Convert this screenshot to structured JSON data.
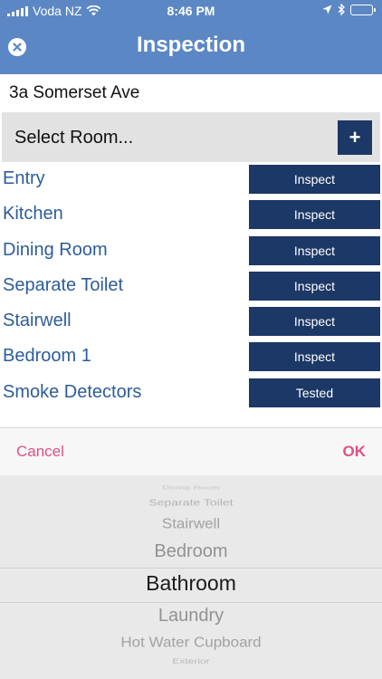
{
  "status_bar": {
    "carrier": "Voda NZ",
    "time": "8:46 PM",
    "icons": [
      "signal-bars-icon",
      "wifi-icon",
      "location-arrow-icon",
      "bluetooth-icon",
      "battery-icon"
    ]
  },
  "header": {
    "title": "Inspection",
    "close_icon": "close-icon"
  },
  "address": "3a Somerset Ave",
  "select_room": {
    "label": "Select Room...",
    "add_label": "+"
  },
  "rooms": [
    {
      "name": "Entry",
      "action": "Inspect"
    },
    {
      "name": "Kitchen",
      "action": "Inspect"
    },
    {
      "name": "Dining Room",
      "action": "Inspect"
    },
    {
      "name": "Separate Toilet",
      "action": "Inspect"
    },
    {
      "name": "Stairwell",
      "action": "Inspect"
    },
    {
      "name": "Bedroom 1",
      "action": "Inspect"
    },
    {
      "name": "Smoke Detectors",
      "action": "Tested"
    }
  ],
  "picker": {
    "cancel_label": "Cancel",
    "ok_label": "OK",
    "items": [
      "Dining Room",
      "Separate Toilet",
      "Stairwell",
      "Bedroom",
      "Bathroom",
      "Laundry",
      "Hot Water Cupboard",
      "Exterior"
    ],
    "selected": "Bathroom"
  },
  "colors": {
    "header": "#5b87c4",
    "button": "#1c3866",
    "room_text": "#2d5c9a",
    "picker_action": "#e14f84"
  }
}
